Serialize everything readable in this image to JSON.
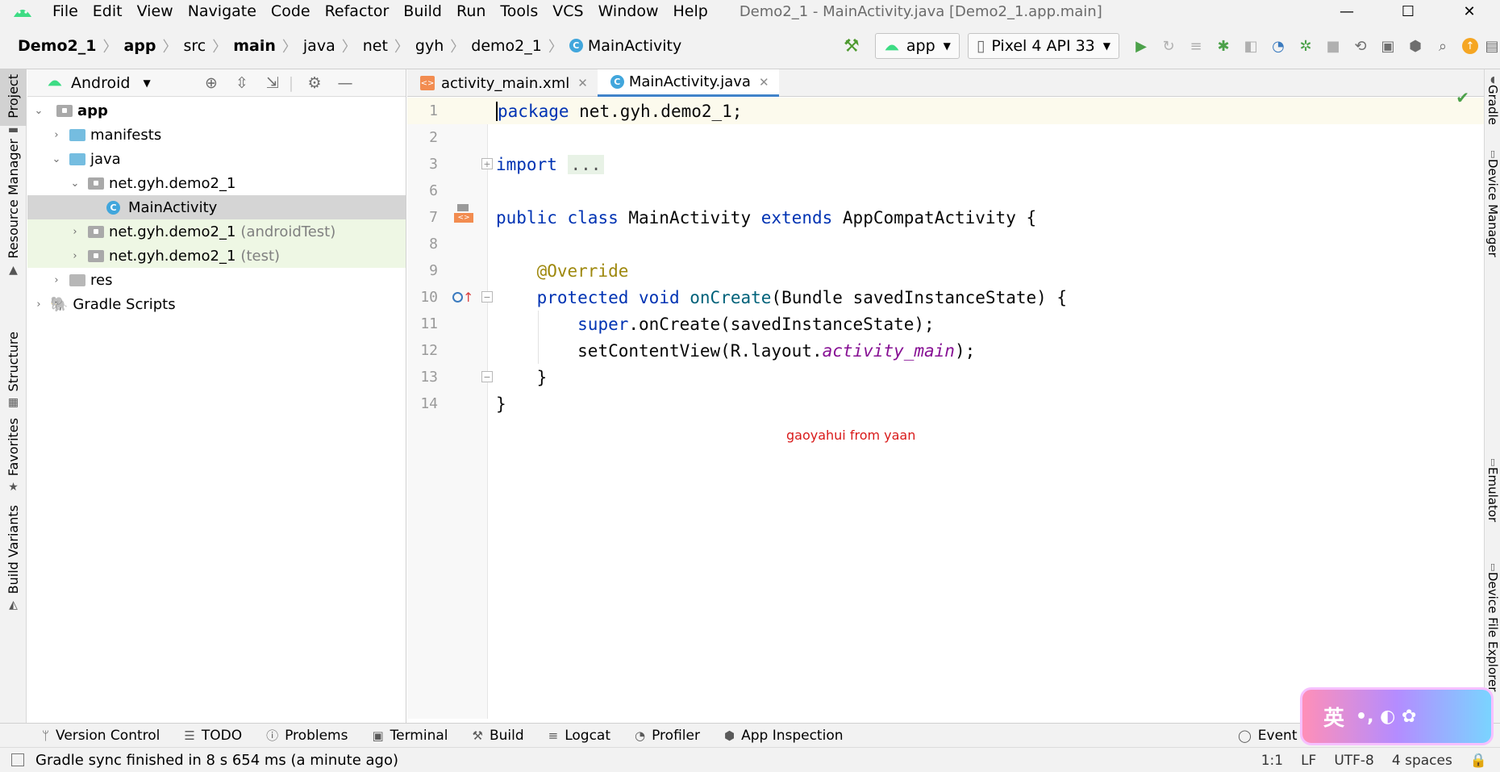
{
  "menubar": {
    "menus": [
      "File",
      "Edit",
      "View",
      "Navigate",
      "Code",
      "Refactor",
      "Build",
      "Run",
      "Tools",
      "VCS",
      "Window",
      "Help"
    ],
    "window_title": "Demo2_1 - MainActivity.java [Demo2_1.app.main]",
    "minimize": "—",
    "maximize": "☐",
    "close": "✕"
  },
  "breadcrumbs": {
    "items": [
      "Demo2_1",
      "app",
      "src",
      "main",
      "java",
      "net",
      "gyh",
      "demo2_1"
    ],
    "current": "MainActivity",
    "separator": "〉"
  },
  "toolbar": {
    "run_config": "app",
    "device": "Pixel 4 API 33"
  },
  "left_strip": {
    "tabs": [
      "Project",
      "Resource Manager",
      "Structure",
      "Favorites",
      "Build Variants"
    ]
  },
  "project_panel": {
    "view_mode": "Android",
    "tree": {
      "app": "app",
      "manifests": "manifests",
      "java": "java",
      "pkg_main": "net.gyh.demo2_1",
      "main_activity": "MainActivity",
      "pkg_android_test": "net.gyh.demo2_1",
      "android_test_suffix": "(androidTest)",
      "pkg_test": "net.gyh.demo2_1",
      "test_suffix": "(test)",
      "res": "res",
      "gradle_scripts": "Gradle Scripts"
    }
  },
  "editor_tabs": [
    {
      "label": "activity_main.xml",
      "active": false
    },
    {
      "label": "MainActivity.java",
      "active": true
    }
  ],
  "code": {
    "line_numbers": [
      "1",
      "2",
      "3",
      "6",
      "7",
      "8",
      "9",
      "10",
      "11",
      "12",
      "13",
      "14"
    ],
    "l1_kw": "package",
    "l1_rest": " net.gyh.demo2_1;",
    "l3_kw": "import",
    "l3_fold": "...",
    "l7_kw1": "public",
    "l7_kw2": "class",
    "l7_name": " MainActivity ",
    "l7_kw3": "extends",
    "l7_rest": " AppCompatActivity {",
    "l9_ann": "@Override",
    "l10_kw1": "protected",
    "l10_kw2": "void",
    "l10_mth": "onCreate",
    "l10_rest": "(Bundle savedInstanceState) {",
    "l11_kw": "super",
    "l11_rest": ".onCreate(savedInstanceState);",
    "l12_pre": "setContentView(R.layout.",
    "l12_ital": "activity_main",
    "l12_post": ");",
    "l13": "}",
    "l14": "}"
  },
  "watermark_text": "gaoyahui from yaan",
  "right_strip": {
    "tabs": [
      "Gradle",
      "Device Manager",
      "Emulator",
      "Device File Explorer"
    ]
  },
  "bottom_bar": {
    "items": [
      "Version Control",
      "TODO",
      "Problems",
      "Terminal",
      "Build",
      "Logcat",
      "Profiler",
      "App Inspection"
    ],
    "event_log": "Event Lo"
  },
  "status_bar": {
    "message": "Gradle sync finished in 8 s 654 ms (a minute ago)",
    "position": "1:1",
    "line_sep": "LF",
    "encoding": "UTF-8",
    "indent": "4 spaces"
  },
  "ime": {
    "label": "英"
  },
  "colors": {
    "keyword": "#0033b3",
    "annotation": "#9e880d",
    "method": "#00627a",
    "italic_field": "#871094",
    "android_green": "#3ddc84",
    "tab_underline": "#4083c9"
  }
}
